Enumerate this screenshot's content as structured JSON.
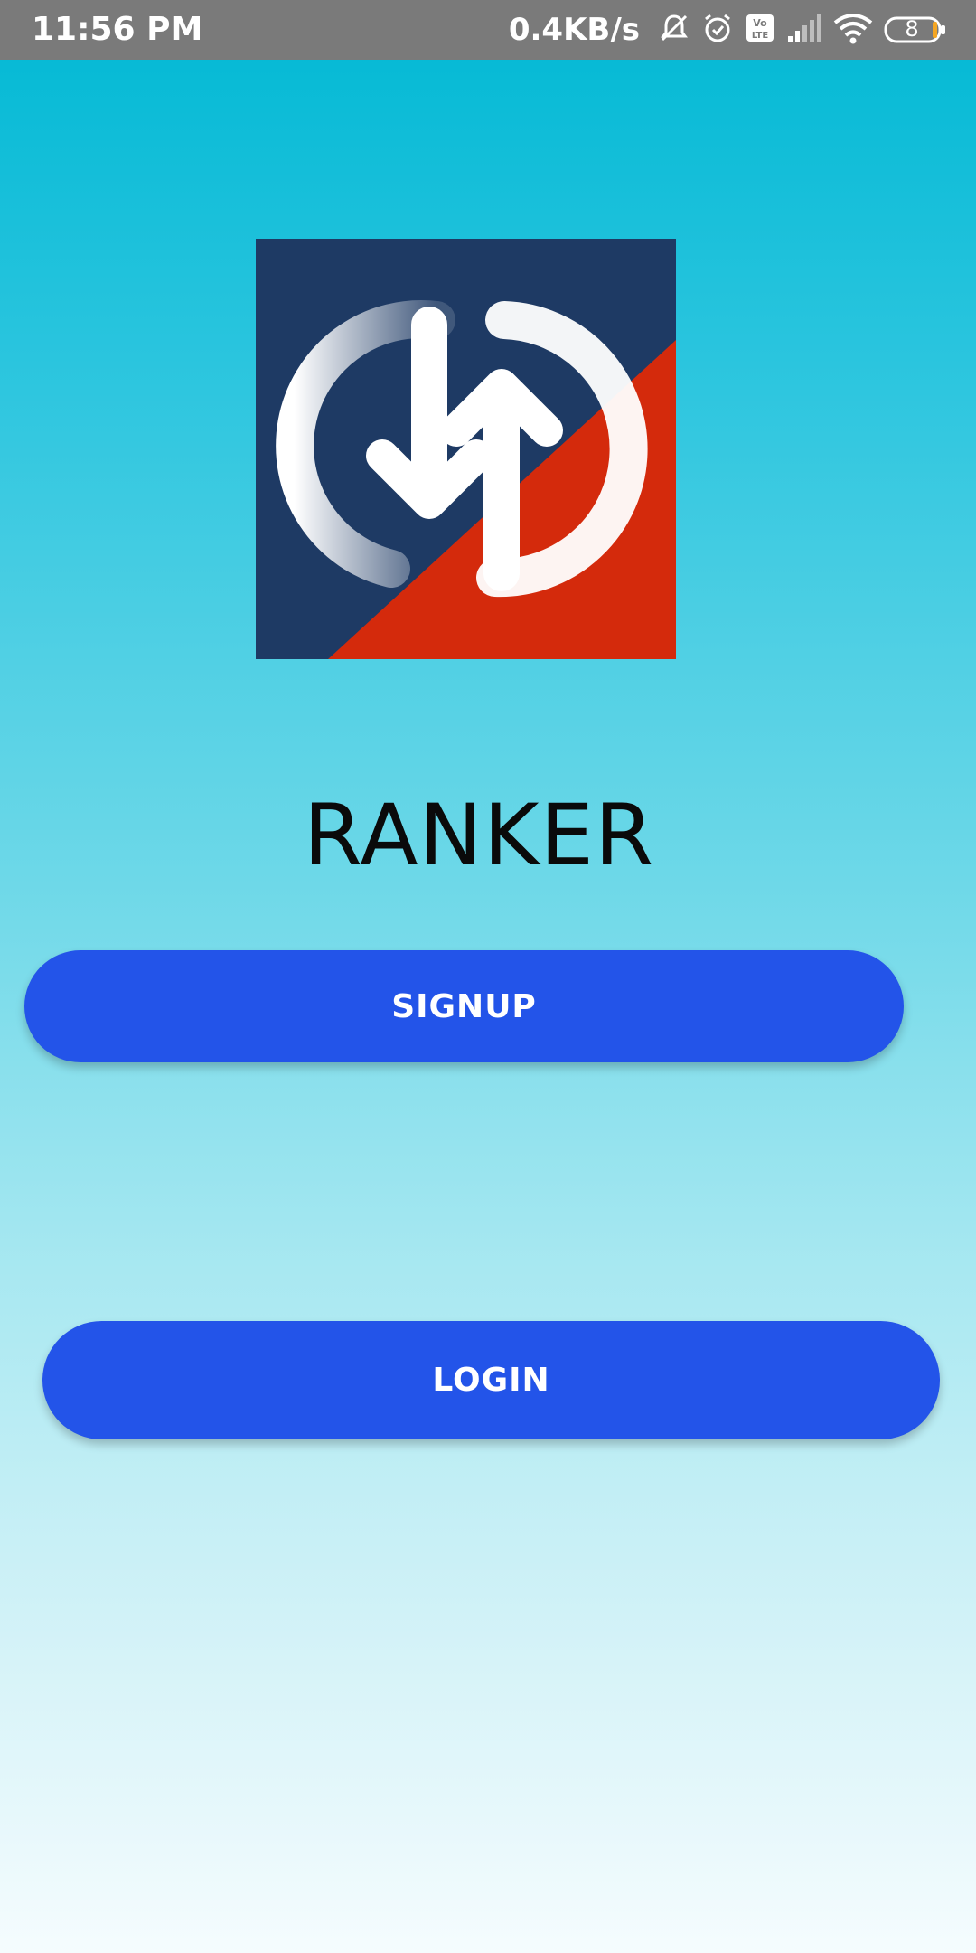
{
  "status_bar": {
    "time": "11:56 PM",
    "network_speed": "0.4KB/s",
    "icons": [
      "mute-bell-icon",
      "alarm-icon",
      "volte-icon",
      "signal-icon",
      "wifi-icon",
      "battery-icon"
    ],
    "battery_level": "8"
  },
  "app": {
    "logo_icon": "ranker-logo-icon",
    "title": "RANKER"
  },
  "buttons": {
    "signup_label": "SIGNUP",
    "login_label": "LOGIN"
  },
  "colors": {
    "button": "#2354e9",
    "status_bar": "#7a7a7a",
    "logo_navy": "#1e3a64",
    "logo_red": "#d42a0c"
  }
}
